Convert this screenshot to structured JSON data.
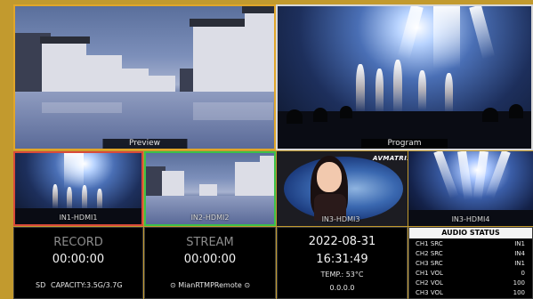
{
  "views": {
    "preview_label": "Preview",
    "program_label": "Program",
    "inputs": [
      {
        "label": "IN1-HDMI1"
      },
      {
        "label": "IN2-HDMI2"
      },
      {
        "label": "IN3-HDMI3"
      },
      {
        "label": "IN3-HDMI4"
      }
    ],
    "in3_logo": "AVMATRIX"
  },
  "record": {
    "title": "RECORD",
    "time": "00:00:00",
    "sd_label": "SD",
    "capacity": "CAPACITY:3.5G/3.7G"
  },
  "stream": {
    "title": "STREAM",
    "time": "00:00:00",
    "remote": "⊙ MianRTMPRemote ⊙"
  },
  "system": {
    "date": "2022-08-31",
    "time": "16:31:49",
    "temp": "TEMP.: 53°C",
    "ip": "0.0.0.0"
  },
  "audio": {
    "title": "AUDIO STATUS",
    "rows": [
      {
        "key": "CH1 SRC",
        "value": "IN1"
      },
      {
        "key": "CH2 SRC",
        "value": "IN4"
      },
      {
        "key": "CH3 SRC",
        "value": "IN1"
      },
      {
        "key": "CH1 VOL",
        "value": "0"
      },
      {
        "key": "CH2 VOL",
        "value": "100"
      },
      {
        "key": "CH3 VOL",
        "value": "100"
      }
    ]
  },
  "colors": {
    "frame": "#c29a2e",
    "preview_border": "#e0a62a",
    "program_border": "#d8d8d8",
    "in1_border": "#d94a3a",
    "in2_border": "#3cc04a"
  }
}
